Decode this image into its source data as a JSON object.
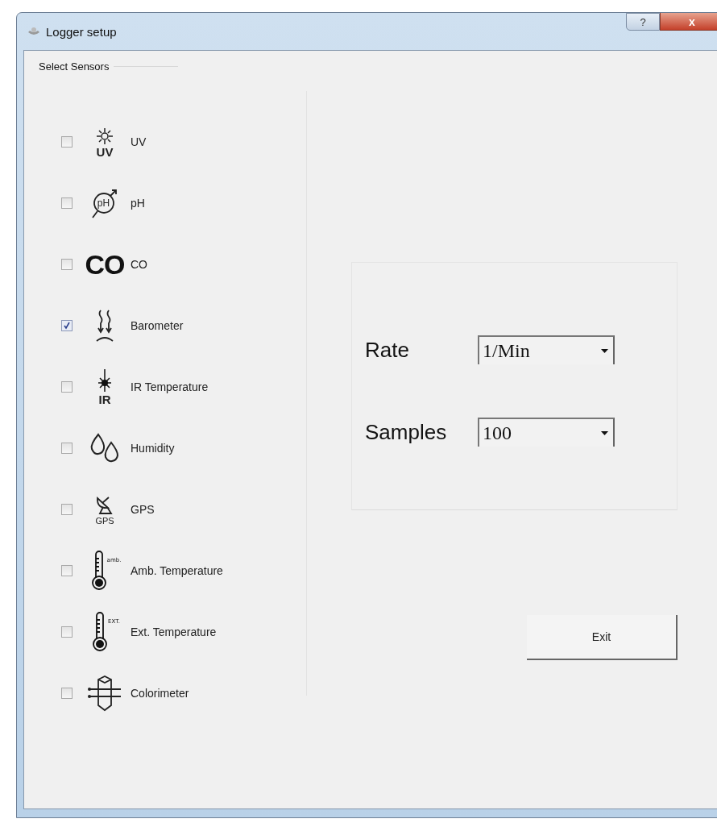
{
  "window": {
    "title": "Logger setup",
    "help_button": "?",
    "close_button": "x"
  },
  "sensor_group": {
    "title": "Select Sensors",
    "sensors": [
      {
        "label": "UV",
        "checked": false,
        "kind": "sun",
        "icon_text": "UV"
      },
      {
        "label": "pH",
        "checked": false,
        "kind": "ph",
        "icon_text": "pH"
      },
      {
        "label": "CO",
        "checked": false,
        "kind": "co",
        "icon_text": "CO"
      },
      {
        "label": "Barometer",
        "checked": true,
        "kind": "barometer"
      },
      {
        "label": "IR Temperature",
        "checked": false,
        "kind": "laser",
        "icon_text": "IR"
      },
      {
        "label": "Humidity",
        "checked": false,
        "kind": "drops"
      },
      {
        "label": "GPS",
        "checked": false,
        "kind": "dish",
        "icon_text": "GPS"
      },
      {
        "label": "Amb. Temperature",
        "checked": false,
        "kind": "thermometer",
        "icon_text": "amb."
      },
      {
        "label": "Ext. Temperature",
        "checked": false,
        "kind": "thermometer",
        "icon_text": "EXT."
      },
      {
        "label": "Colorimeter",
        "checked": false,
        "kind": "colorimeter"
      }
    ]
  },
  "settings": [
    {
      "label": "Rate",
      "value": "1/Min"
    },
    {
      "label": "Samples",
      "value": "100"
    }
  ],
  "exit_button": "Exit"
}
